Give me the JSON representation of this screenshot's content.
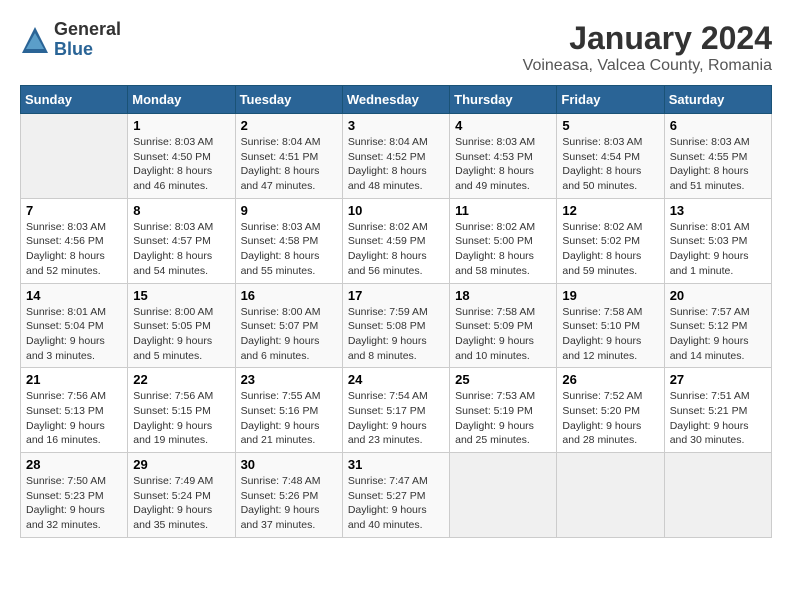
{
  "header": {
    "logo_general": "General",
    "logo_blue": "Blue",
    "title": "January 2024",
    "subtitle": "Voineasa, Valcea County, Romania"
  },
  "weekdays": [
    "Sunday",
    "Monday",
    "Tuesday",
    "Wednesday",
    "Thursday",
    "Friday",
    "Saturday"
  ],
  "weeks": [
    [
      {
        "day": "",
        "sunrise": "",
        "sunset": "",
        "daylight": ""
      },
      {
        "day": "1",
        "sunrise": "Sunrise: 8:03 AM",
        "sunset": "Sunset: 4:50 PM",
        "daylight": "Daylight: 8 hours and 46 minutes."
      },
      {
        "day": "2",
        "sunrise": "Sunrise: 8:04 AM",
        "sunset": "Sunset: 4:51 PM",
        "daylight": "Daylight: 8 hours and 47 minutes."
      },
      {
        "day": "3",
        "sunrise": "Sunrise: 8:04 AM",
        "sunset": "Sunset: 4:52 PM",
        "daylight": "Daylight: 8 hours and 48 minutes."
      },
      {
        "day": "4",
        "sunrise": "Sunrise: 8:03 AM",
        "sunset": "Sunset: 4:53 PM",
        "daylight": "Daylight: 8 hours and 49 minutes."
      },
      {
        "day": "5",
        "sunrise": "Sunrise: 8:03 AM",
        "sunset": "Sunset: 4:54 PM",
        "daylight": "Daylight: 8 hours and 50 minutes."
      },
      {
        "day": "6",
        "sunrise": "Sunrise: 8:03 AM",
        "sunset": "Sunset: 4:55 PM",
        "daylight": "Daylight: 8 hours and 51 minutes."
      }
    ],
    [
      {
        "day": "7",
        "sunrise": "Sunrise: 8:03 AM",
        "sunset": "Sunset: 4:56 PM",
        "daylight": "Daylight: 8 hours and 52 minutes."
      },
      {
        "day": "8",
        "sunrise": "Sunrise: 8:03 AM",
        "sunset": "Sunset: 4:57 PM",
        "daylight": "Daylight: 8 hours and 54 minutes."
      },
      {
        "day": "9",
        "sunrise": "Sunrise: 8:03 AM",
        "sunset": "Sunset: 4:58 PM",
        "daylight": "Daylight: 8 hours and 55 minutes."
      },
      {
        "day": "10",
        "sunrise": "Sunrise: 8:02 AM",
        "sunset": "Sunset: 4:59 PM",
        "daylight": "Daylight: 8 hours and 56 minutes."
      },
      {
        "day": "11",
        "sunrise": "Sunrise: 8:02 AM",
        "sunset": "Sunset: 5:00 PM",
        "daylight": "Daylight: 8 hours and 58 minutes."
      },
      {
        "day": "12",
        "sunrise": "Sunrise: 8:02 AM",
        "sunset": "Sunset: 5:02 PM",
        "daylight": "Daylight: 8 hours and 59 minutes."
      },
      {
        "day": "13",
        "sunrise": "Sunrise: 8:01 AM",
        "sunset": "Sunset: 5:03 PM",
        "daylight": "Daylight: 9 hours and 1 minute."
      }
    ],
    [
      {
        "day": "14",
        "sunrise": "Sunrise: 8:01 AM",
        "sunset": "Sunset: 5:04 PM",
        "daylight": "Daylight: 9 hours and 3 minutes."
      },
      {
        "day": "15",
        "sunrise": "Sunrise: 8:00 AM",
        "sunset": "Sunset: 5:05 PM",
        "daylight": "Daylight: 9 hours and 5 minutes."
      },
      {
        "day": "16",
        "sunrise": "Sunrise: 8:00 AM",
        "sunset": "Sunset: 5:07 PM",
        "daylight": "Daylight: 9 hours and 6 minutes."
      },
      {
        "day": "17",
        "sunrise": "Sunrise: 7:59 AM",
        "sunset": "Sunset: 5:08 PM",
        "daylight": "Daylight: 9 hours and 8 minutes."
      },
      {
        "day": "18",
        "sunrise": "Sunrise: 7:58 AM",
        "sunset": "Sunset: 5:09 PM",
        "daylight": "Daylight: 9 hours and 10 minutes."
      },
      {
        "day": "19",
        "sunrise": "Sunrise: 7:58 AM",
        "sunset": "Sunset: 5:10 PM",
        "daylight": "Daylight: 9 hours and 12 minutes."
      },
      {
        "day": "20",
        "sunrise": "Sunrise: 7:57 AM",
        "sunset": "Sunset: 5:12 PM",
        "daylight": "Daylight: 9 hours and 14 minutes."
      }
    ],
    [
      {
        "day": "21",
        "sunrise": "Sunrise: 7:56 AM",
        "sunset": "Sunset: 5:13 PM",
        "daylight": "Daylight: 9 hours and 16 minutes."
      },
      {
        "day": "22",
        "sunrise": "Sunrise: 7:56 AM",
        "sunset": "Sunset: 5:15 PM",
        "daylight": "Daylight: 9 hours and 19 minutes."
      },
      {
        "day": "23",
        "sunrise": "Sunrise: 7:55 AM",
        "sunset": "Sunset: 5:16 PM",
        "daylight": "Daylight: 9 hours and 21 minutes."
      },
      {
        "day": "24",
        "sunrise": "Sunrise: 7:54 AM",
        "sunset": "Sunset: 5:17 PM",
        "daylight": "Daylight: 9 hours and 23 minutes."
      },
      {
        "day": "25",
        "sunrise": "Sunrise: 7:53 AM",
        "sunset": "Sunset: 5:19 PM",
        "daylight": "Daylight: 9 hours and 25 minutes."
      },
      {
        "day": "26",
        "sunrise": "Sunrise: 7:52 AM",
        "sunset": "Sunset: 5:20 PM",
        "daylight": "Daylight: 9 hours and 28 minutes."
      },
      {
        "day": "27",
        "sunrise": "Sunrise: 7:51 AM",
        "sunset": "Sunset: 5:21 PM",
        "daylight": "Daylight: 9 hours and 30 minutes."
      }
    ],
    [
      {
        "day": "28",
        "sunrise": "Sunrise: 7:50 AM",
        "sunset": "Sunset: 5:23 PM",
        "daylight": "Daylight: 9 hours and 32 minutes."
      },
      {
        "day": "29",
        "sunrise": "Sunrise: 7:49 AM",
        "sunset": "Sunset: 5:24 PM",
        "daylight": "Daylight: 9 hours and 35 minutes."
      },
      {
        "day": "30",
        "sunrise": "Sunrise: 7:48 AM",
        "sunset": "Sunset: 5:26 PM",
        "daylight": "Daylight: 9 hours and 37 minutes."
      },
      {
        "day": "31",
        "sunrise": "Sunrise: 7:47 AM",
        "sunset": "Sunset: 5:27 PM",
        "daylight": "Daylight: 9 hours and 40 minutes."
      },
      {
        "day": "",
        "sunrise": "",
        "sunset": "",
        "daylight": ""
      },
      {
        "day": "",
        "sunrise": "",
        "sunset": "",
        "daylight": ""
      },
      {
        "day": "",
        "sunrise": "",
        "sunset": "",
        "daylight": ""
      }
    ]
  ]
}
